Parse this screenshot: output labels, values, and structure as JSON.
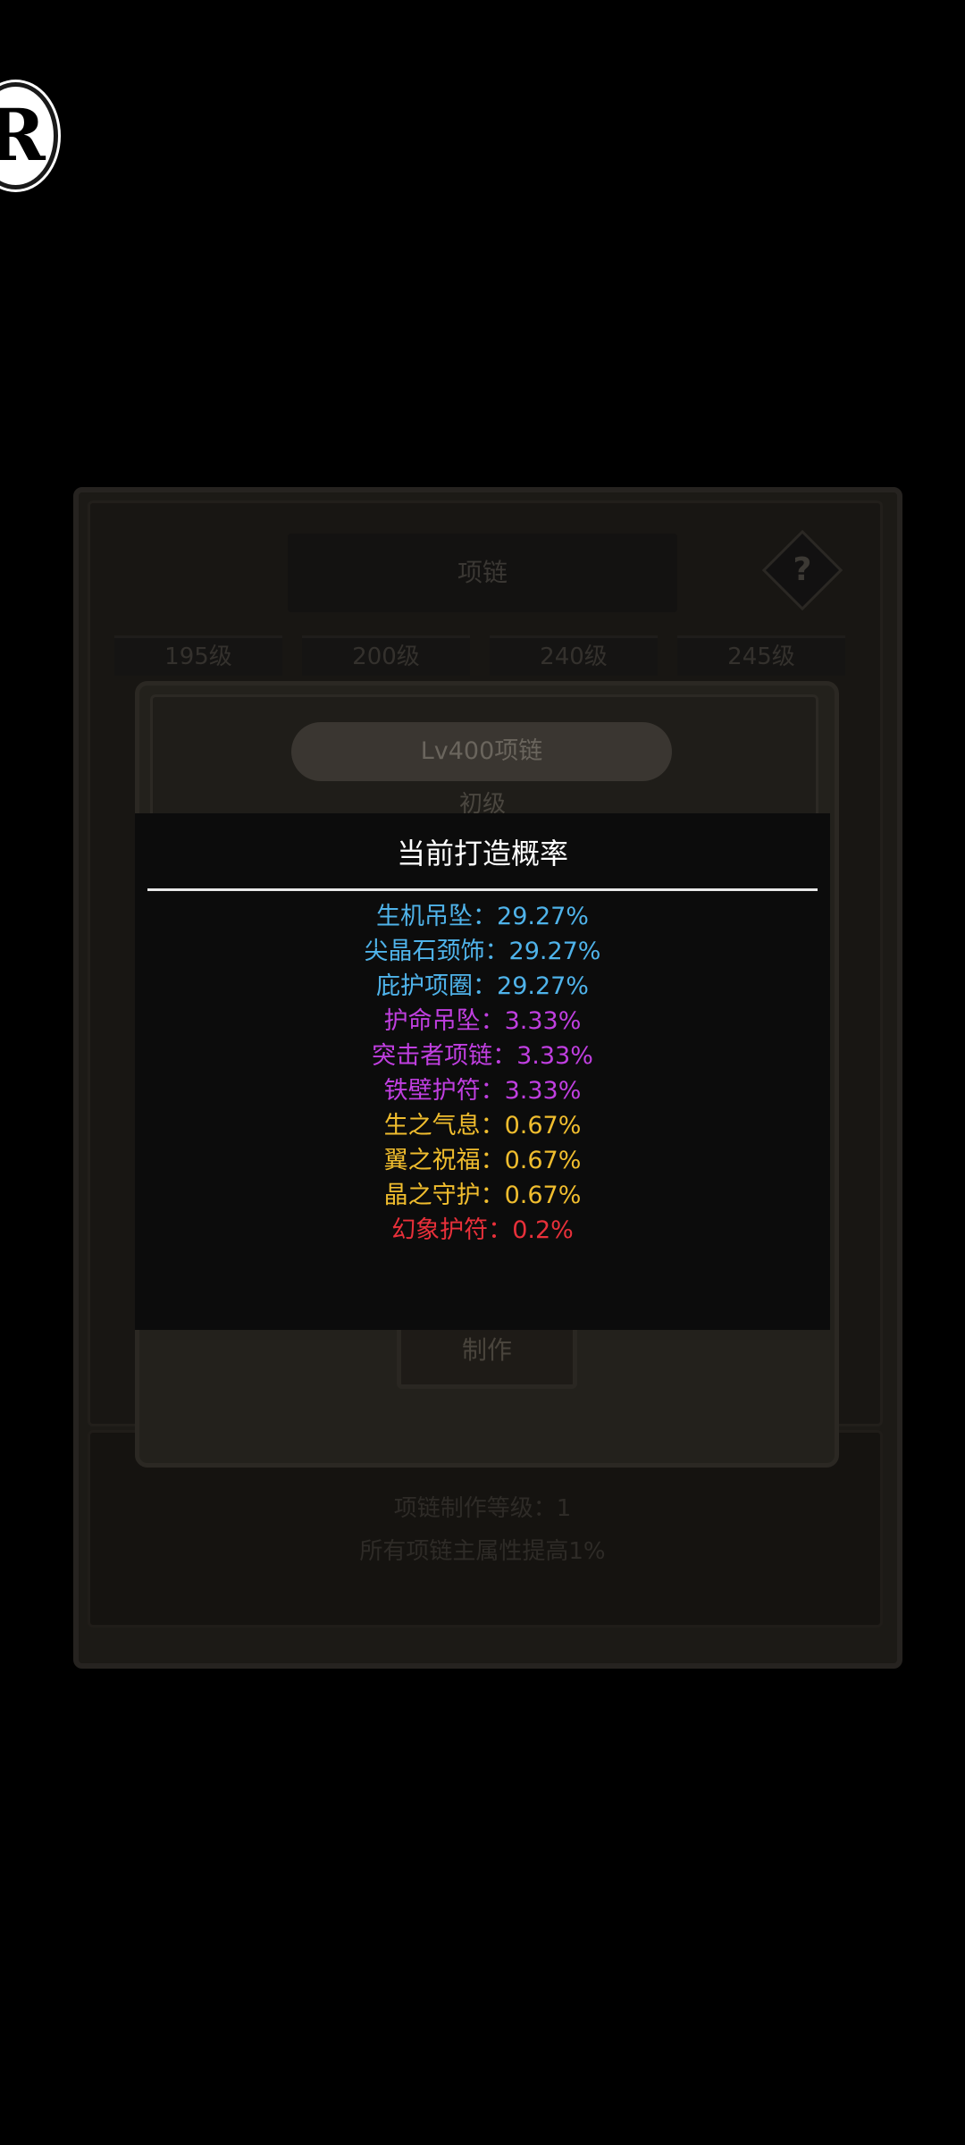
{
  "background": {
    "logo_letter": "R",
    "title_box": "项链",
    "help_icon": "?",
    "level_tabs": [
      "195级",
      "200级",
      "240级",
      "245级"
    ],
    "card_level": "Lv400项链",
    "card_grade": "初级",
    "craft_button": "制作",
    "footer_lines": [
      "项链制作等级：1",
      "所有项链主属性提高1%"
    ]
  },
  "modal": {
    "title": "当前打造概率",
    "rates": [
      {
        "name": "生机吊坠",
        "value": "29.27%",
        "color": "#4fb3ea"
      },
      {
        "name": "尖晶石颈饰",
        "value": "29.27%",
        "color": "#4fb3ea"
      },
      {
        "name": "庇护项圈",
        "value": "29.27%",
        "color": "#4fb3ea"
      },
      {
        "name": "护命吊坠",
        "value": "3.33%",
        "color": "#c03fe0"
      },
      {
        "name": "突击者项链",
        "value": "3.33%",
        "color": "#c03fe0"
      },
      {
        "name": "铁壁护符",
        "value": "3.33%",
        "color": "#c03fe0"
      },
      {
        "name": "生之气息",
        "value": "0.67%",
        "color": "#f0bd2e"
      },
      {
        "name": "翼之祝福",
        "value": "0.67%",
        "color": "#f0bd2e"
      },
      {
        "name": "晶之守护",
        "value": "0.67%",
        "color": "#f0bd2e"
      },
      {
        "name": "幻象护符",
        "value": "0.2%",
        "color": "#e8303a"
      }
    ]
  }
}
